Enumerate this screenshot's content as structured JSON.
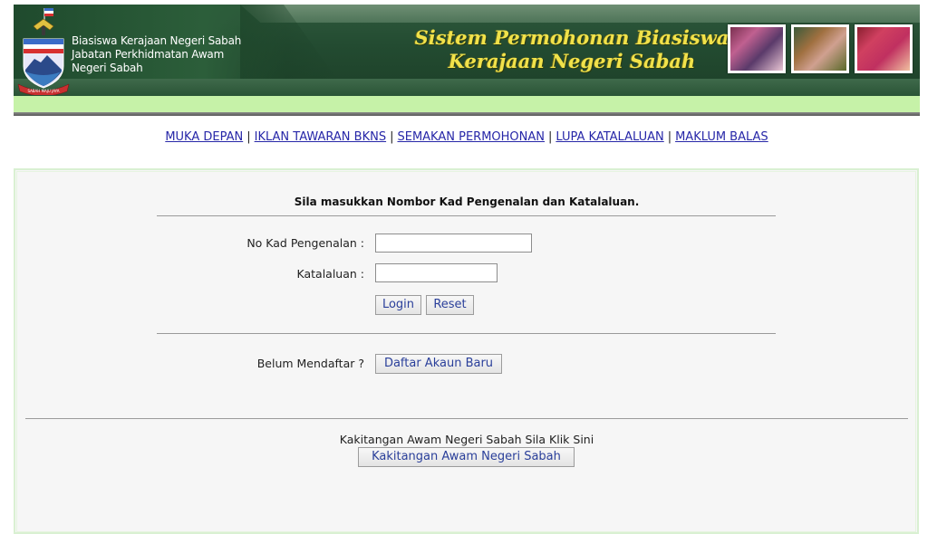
{
  "header": {
    "agency_lines": [
      "Biasiswa Kerajaan Negeri Sabah",
      "Jabatan Perkhidmatan Awam",
      "Negeri Sabah"
    ],
    "system_title_line1": "Sistem Permohonan Biasiswa",
    "system_title_line2": "Kerajaan Negeri Sabah",
    "crest_motto": "SABAH MAJU JAYA",
    "colors": {
      "banner": "#234b31",
      "title": "#f1e24a",
      "lightstrip": "#c6f2a8"
    }
  },
  "nav": {
    "items": [
      {
        "label": "MUKA DEPAN"
      },
      {
        "label": "IKLAN TAWARAN BKNS"
      },
      {
        "label": "SEMAKAN PERMOHONAN"
      },
      {
        "label": "LUPA KATALALUAN"
      },
      {
        "label": "MAKLUM BALAS"
      }
    ],
    "separator": "|"
  },
  "login": {
    "instruction": "Sila masukkan Nombor Kad Pengenalan dan Katalaluan.",
    "ic_label": "No Kad Pengenalan :",
    "ic_value": "",
    "password_label": "Katalaluan :",
    "password_value": "",
    "login_button": "Login",
    "reset_button": "Reset"
  },
  "register": {
    "prompt": "Belum Mendaftar ?",
    "button": "Daftar Akaun Baru"
  },
  "staff": {
    "text": "Kakitangan Awam Negeri Sabah Sila Klik Sini",
    "button": "Kakitangan Awam Negeri Sabah"
  }
}
